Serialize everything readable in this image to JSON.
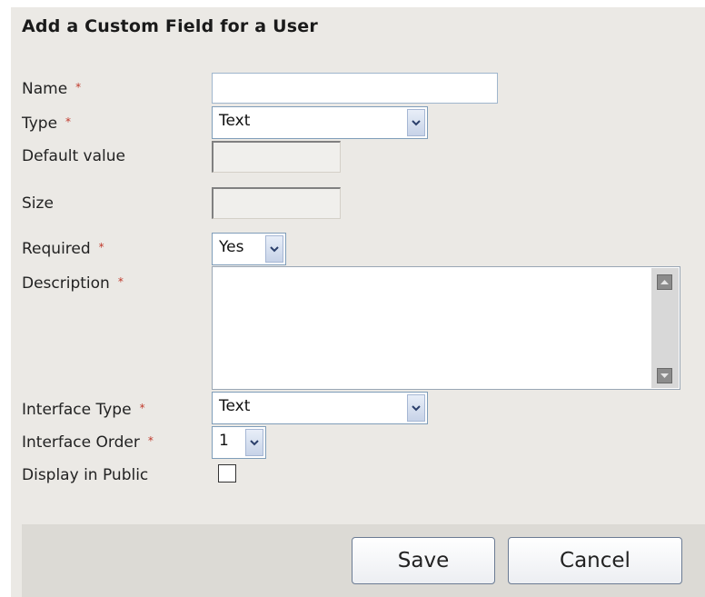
{
  "form": {
    "title": "Add a Custom Field for a User",
    "required_marker": "*",
    "fields": {
      "name": {
        "label": "Name",
        "value": ""
      },
      "type": {
        "label": "Type",
        "selected": "Text"
      },
      "default_value": {
        "label": "Default value",
        "value": ""
      },
      "size": {
        "label": "Size",
        "value": ""
      },
      "required": {
        "label": "Required",
        "selected": "Yes"
      },
      "description": {
        "label": "Description",
        "value": ""
      },
      "interface_type": {
        "label": "Interface Type",
        "selected": "Text"
      },
      "interface_order": {
        "label": "Interface Order",
        "selected": "1"
      },
      "display_in_public": {
        "label": "Display in Public",
        "checked": false
      }
    }
  },
  "footer": {
    "save_label": "Save",
    "cancel_label": "Cancel"
  }
}
